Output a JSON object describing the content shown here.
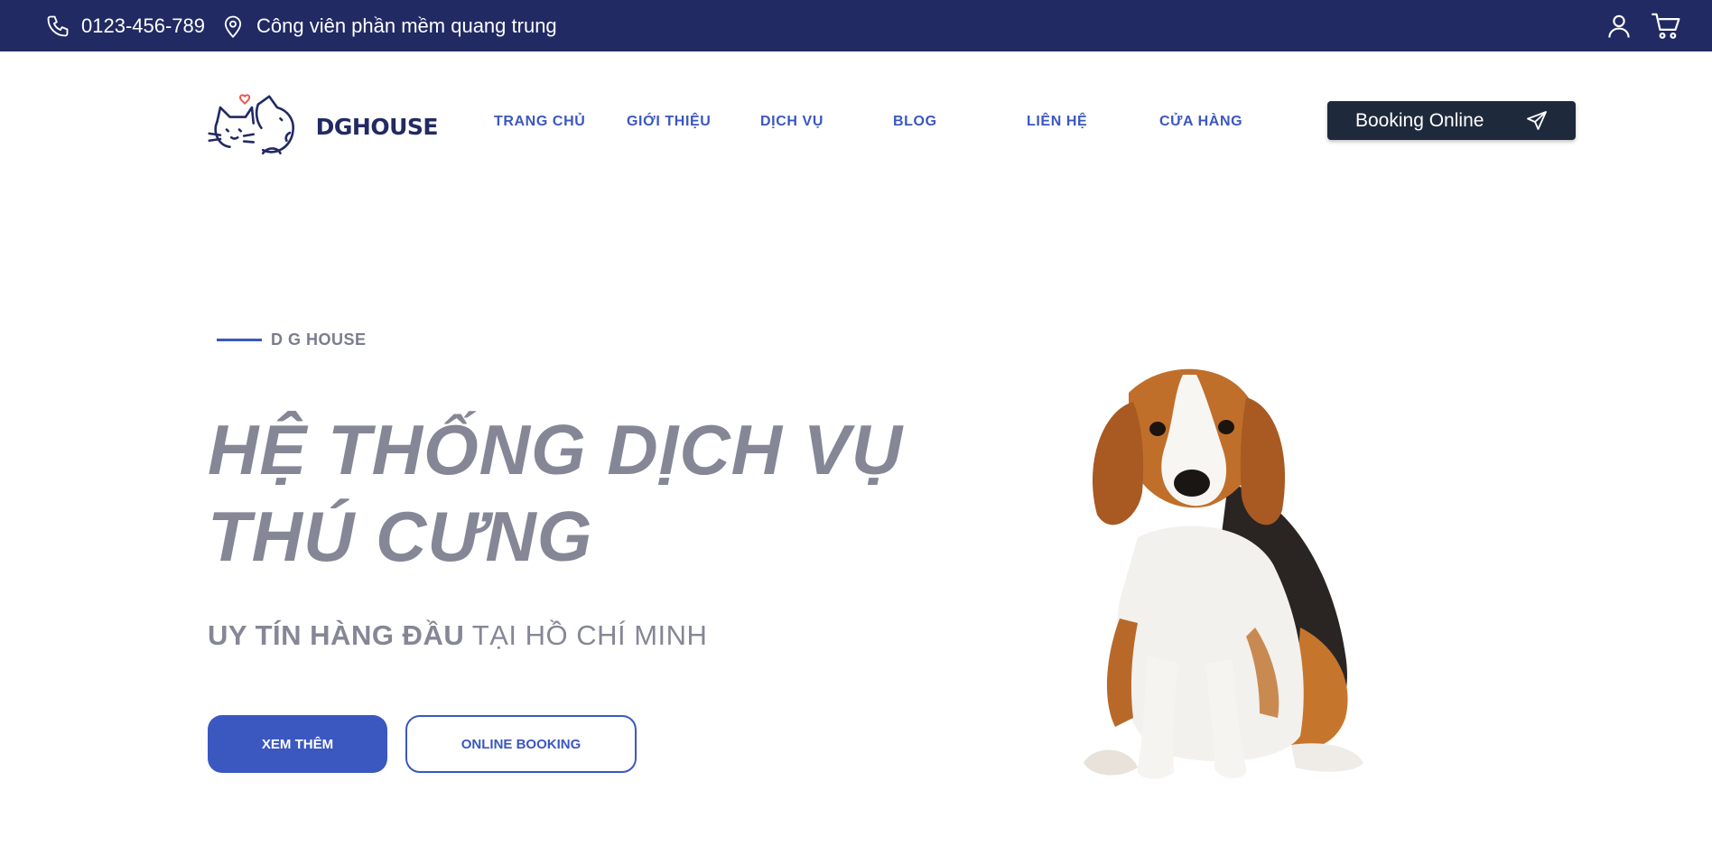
{
  "topbar": {
    "phone": "0123-456-789",
    "address": "Công viên phần mềm quang trung",
    "icons": [
      "phone-icon",
      "location-pin-icon",
      "user-icon",
      "cart-icon"
    ]
  },
  "header": {
    "logo_text": "DGHOUSE",
    "nav": [
      {
        "label": "TRANG CHỦ"
      },
      {
        "label": "GIỚI THIỆU"
      },
      {
        "label": "DỊCH VỤ"
      },
      {
        "label": "BLOG"
      },
      {
        "label": "LIÊN HỆ"
      },
      {
        "label": "CỬA HÀNG"
      }
    ],
    "booking_label": "Booking Online"
  },
  "hero": {
    "eyebrow": "D G HOUSE",
    "title_line1": "HỆ THỐNG DỊCH VỤ",
    "title_line2": "THÚ CƯNG",
    "subtitle_bold": "UY TÍN HÀNG ĐẦU",
    "subtitle_rest": " TẠI HỒ CHÍ MINH",
    "btn_more": "XEM THÊM",
    "btn_booking": "ONLINE BOOKING"
  },
  "colors": {
    "topbar": "#212a63",
    "accent": "#3b57c0",
    "booking_btn": "#1e2a3b",
    "hero_text": "#858796"
  }
}
